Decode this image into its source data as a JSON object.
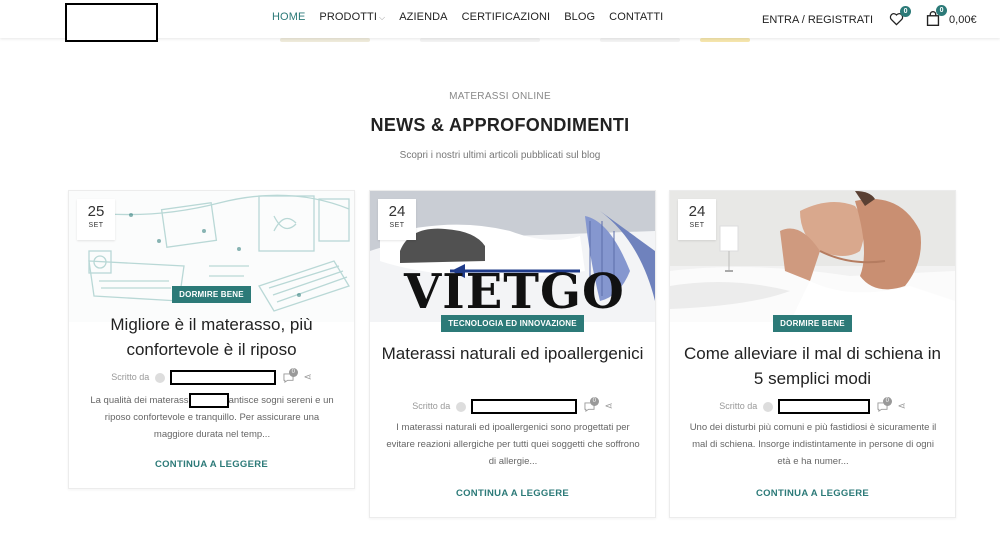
{
  "header": {
    "nav": [
      "HOME",
      "PRODOTTI",
      "AZIENDA",
      "CERTIFICAZIONI",
      "BLOG",
      "CONTATTI"
    ],
    "login": "ENTRA / REGISTRATI",
    "wishlist_count": "0",
    "cart_count": "0",
    "cart_total": "0,00€"
  },
  "section": {
    "eyebrow": "MATERASSI ONLINE",
    "title": "NEWS & APPROFONDIMENTI",
    "subtitle": "Scopri i nostri ultimi articoli pubblicati sul blog"
  },
  "posts": [
    {
      "day": "25",
      "month": "SET",
      "category": "DORMIRE BENE",
      "title": "Migliore è il materasso, più confortevole è il riposo",
      "author_label": "Scritto da",
      "comments": "0",
      "excerpt_a": "La qualità dei materass",
      "excerpt_b": "antisce sogni sereni e un riposo confortevole e tranquillo. Per assicurare una maggiore durata nel temp...",
      "more": "CONTINUA A LEGGERE"
    },
    {
      "day": "24",
      "month": "SET",
      "category": "TECNOLOGIA ED INNOVAZIONE",
      "title": "Materassi naturali ed ipoallergenici",
      "author_label": "Scritto da",
      "comments": "0",
      "excerpt": "I materassi naturali ed ipoallergenici sono progettati per evitare reazioni allergiche per tutti quei soggetti che soffrono di allergie...",
      "more": "CONTINUA A LEGGERE"
    },
    {
      "day": "24",
      "month": "SET",
      "category": "DORMIRE BENE",
      "title": "Come alleviare il mal di schiena in 5 semplici modi",
      "author_label": "Scritto da",
      "comments": "0",
      "excerpt": "Uno dei disturbi più comuni e più fastidiosi è sicuramente il mal di schiena. Insorge indistintamente in persone di ogni età e ha numer...",
      "more": "CONTINUA A LEGGERE"
    }
  ],
  "watermark": "VIETGO",
  "colors": {
    "accent": "#2c7a78"
  }
}
